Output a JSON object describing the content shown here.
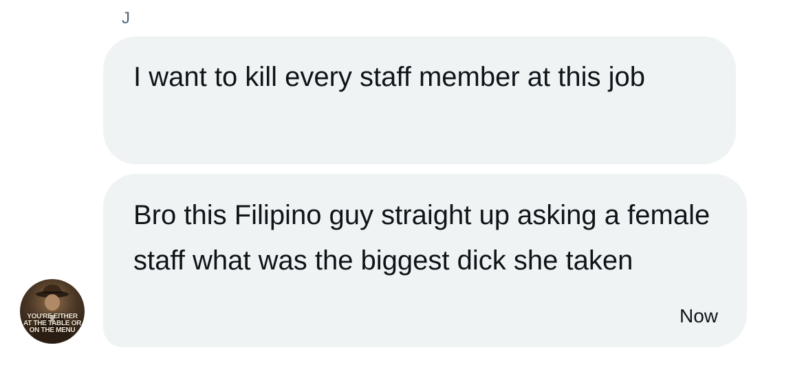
{
  "conversation": {
    "sender_name": "J",
    "messages": [
      {
        "text": "I want to kill every staff member at this job"
      },
      {
        "text": "Bro this Filipino guy straight up asking a female staff what was the biggest dick she taken",
        "timestamp": "Now"
      }
    ]
  },
  "avatar": {
    "icon": "profile-avatar-fedora-man",
    "caption_lines": [
      "YOU'RE EITHER",
      "AT THE TABLE OR",
      "ON THE MENU"
    ]
  },
  "colors": {
    "bubble_background": "#eff3f4",
    "text": "#0f1419",
    "secondary_text": "#536471"
  }
}
